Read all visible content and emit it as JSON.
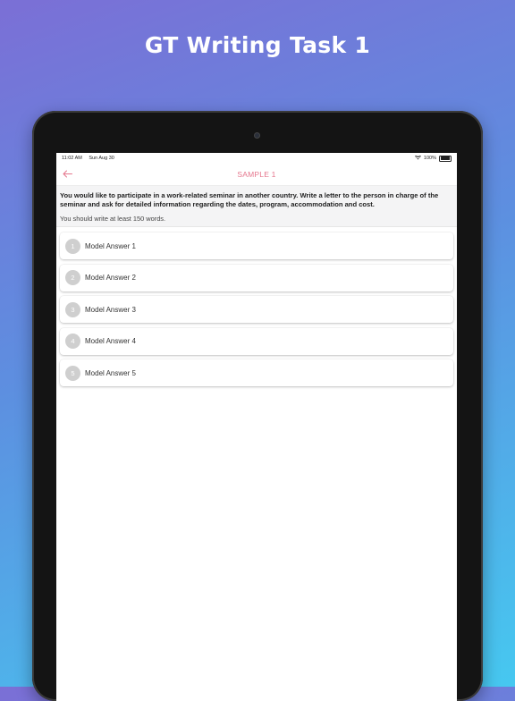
{
  "promo": {
    "title": "GT Writing Task 1"
  },
  "status_bar": {
    "time": "11:02 AM",
    "date": "Sun Aug 30",
    "battery": "100%"
  },
  "nav": {
    "title": "SAMPLE 1",
    "back_icon": "arrow-left-icon"
  },
  "colors": {
    "accent": "#e5768d"
  },
  "question": {
    "prompt": "You would like to participate in a work-related seminar in another country. Write a letter to the person in charge of the seminar and ask for detailed information regarding the dates, program, accommodation and cost.",
    "note": "You should write at least 150 words."
  },
  "answers": [
    {
      "number": "1",
      "label": "Model Answer 1"
    },
    {
      "number": "2",
      "label": "Model Answer 2"
    },
    {
      "number": "3",
      "label": "Model Answer 3"
    },
    {
      "number": "4",
      "label": "Model Answer 4"
    },
    {
      "number": "5",
      "label": "Model Answer 5"
    }
  ]
}
